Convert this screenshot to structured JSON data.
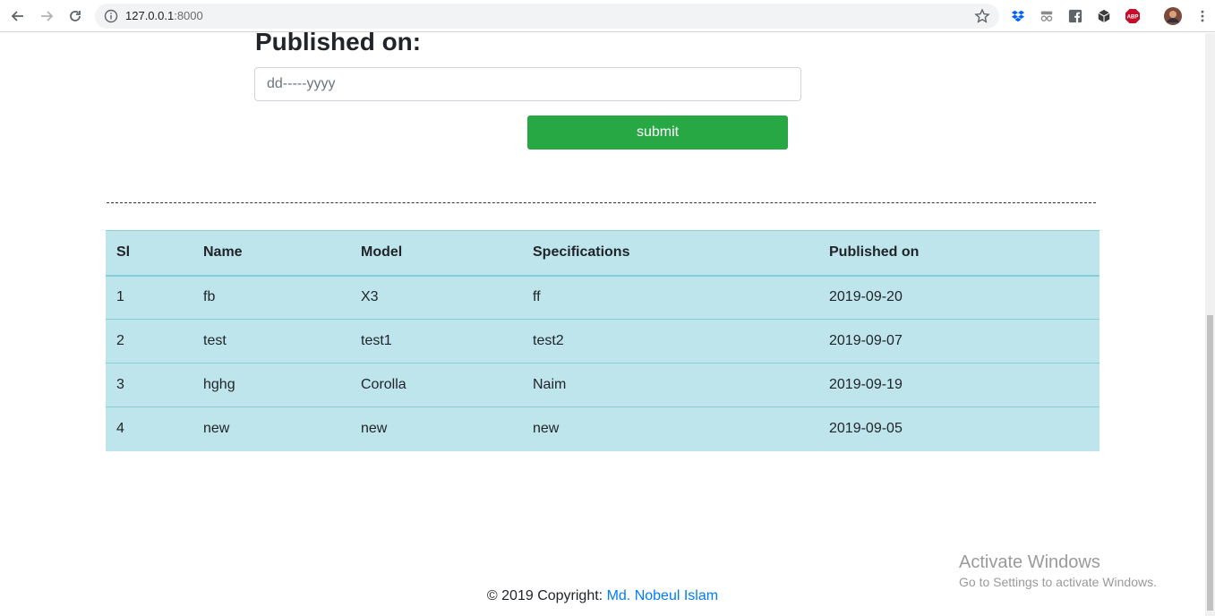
{
  "browser": {
    "url_host": "127.0.0.1",
    "url_port": ":8000"
  },
  "form": {
    "label": "Published on:",
    "date_placeholder": "dd-----yyyy",
    "submit_label": "submit"
  },
  "table": {
    "headers": [
      "Sl",
      "Name",
      "Model",
      "Specifications",
      "Published on"
    ],
    "rows": [
      [
        "1",
        "fb",
        "X3",
        "ff",
        "2019-09-20"
      ],
      [
        "2",
        "test",
        "test1",
        "test2",
        "2019-09-07"
      ],
      [
        "3",
        "hghg",
        "Corolla",
        "Naim",
        "2019-09-19"
      ],
      [
        "4",
        "new",
        "new",
        "new",
        "2019-09-05"
      ]
    ]
  },
  "footer": {
    "prefix": "© 2019 Copyright:",
    "author": "Md. Nobeul Islam"
  },
  "watermark": {
    "line1": "Activate Windows",
    "line2": "Go to Settings to activate Windows."
  },
  "colors": {
    "submit_bg": "#28a745",
    "table_bg": "#bee5eb",
    "link": "#007bff"
  }
}
